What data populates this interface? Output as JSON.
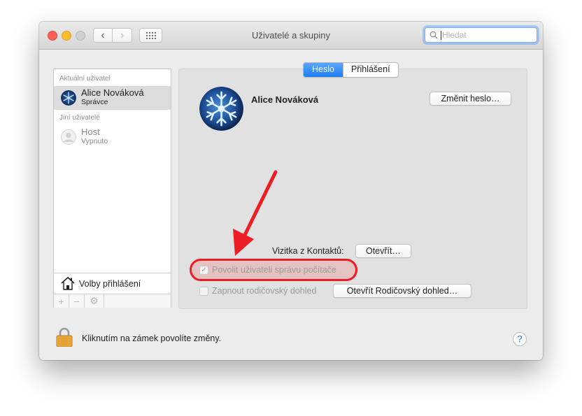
{
  "window": {
    "title": "Uživatelé a skupiny"
  },
  "toolbar": {
    "back_glyph": "‹",
    "forward_glyph": "›",
    "grid_icon": "grid-icon"
  },
  "search": {
    "placeholder": "Hledat"
  },
  "sidebar": {
    "current_section": "Aktuální uživatel",
    "others_section": "Jiní uživatelé",
    "current_user": {
      "name": "Alice Nováková",
      "role": "Správce",
      "avatar": "snowflake-avatar-icon"
    },
    "other_users": [
      {
        "name": "Host",
        "status": "Vypnuto",
        "avatar": "person-icon"
      }
    ],
    "login_options": "Volby přihlášení",
    "toolbar": {
      "add": "+",
      "remove": "−",
      "settings": "⚙"
    }
  },
  "tabs": {
    "password": "Heslo",
    "login": "Přihlášení",
    "active": "Heslo"
  },
  "user_detail": {
    "full_name": "Alice Nováková",
    "change_password_button": "Změnit heslo…",
    "contacts_card_label": "Vizitka z Kontaktů:",
    "open_button": "Otevřít…",
    "allow_admin_label": "Povolit uživateli správu počítače",
    "allow_admin_checked": true,
    "parental_label": "Zapnout rodičovský dohled",
    "parental_checked": false,
    "open_parental_button": "Otevřít Rodičovský dohled…"
  },
  "footer": {
    "lock_text": "Kliknutím na zámek povolíte změny.",
    "help": "?"
  },
  "annotation": {
    "highlight_color": "#ee1c23",
    "arrow_color": "#ee1c23"
  },
  "colors": {
    "accent": "#1e7ef4",
    "window_bg": "#ececec",
    "panel_bg": "#e1e1e1"
  }
}
